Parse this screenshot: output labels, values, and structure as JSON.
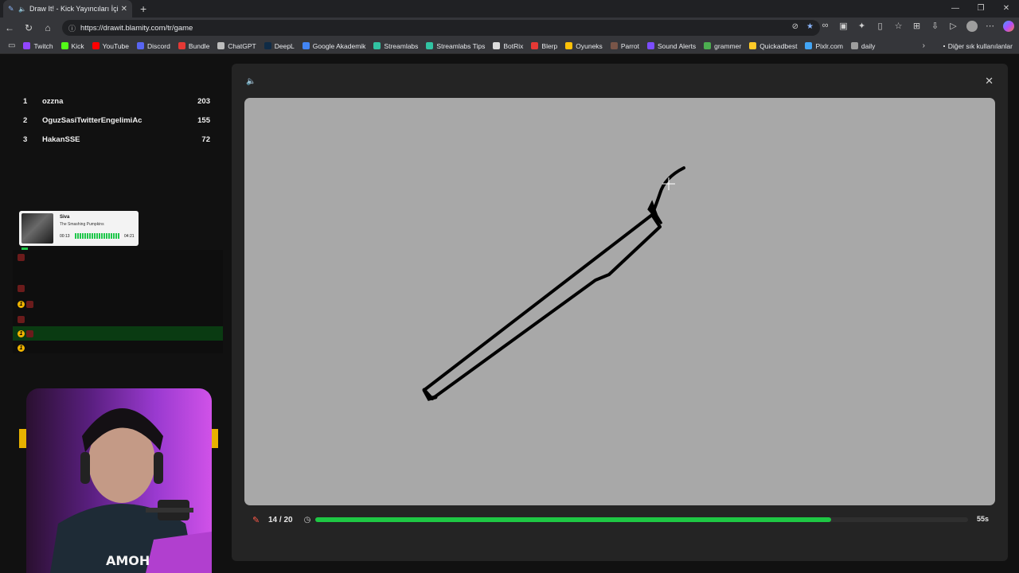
{
  "browser": {
    "tab_title": "Draw It! - Kick Yayıncıları İçin Ç",
    "url": "https://drawit.blamity.com/tr/game",
    "bookmarks": [
      {
        "label": "Twitch",
        "color": "#9146ff"
      },
      {
        "label": "Kick",
        "color": "#53fc18"
      },
      {
        "label": "YouTube",
        "color": "#ff0000"
      },
      {
        "label": "Discord",
        "color": "#5865f2"
      },
      {
        "label": "Bundle",
        "color": "#e53935"
      },
      {
        "label": "ChatGPT",
        "color": "#bdbdbd"
      },
      {
        "label": "DeepL",
        "color": "#0f2b46"
      },
      {
        "label": "Google Akademik",
        "color": "#4285f4"
      },
      {
        "label": "Streamlabs",
        "color": "#31c3a2"
      },
      {
        "label": "Streamlabs Tips",
        "color": "#31c3a2"
      },
      {
        "label": "BotRix",
        "color": "#dddddd"
      },
      {
        "label": "Blerp",
        "color": "#e53935"
      },
      {
        "label": "Oyuneks",
        "color": "#ffc107"
      },
      {
        "label": "Parrot",
        "color": "#795548"
      },
      {
        "label": "Sound Alerts",
        "color": "#7c4dff"
      },
      {
        "label": "grammer",
        "color": "#4caf50"
      },
      {
        "label": "Quickadbest",
        "color": "#ffca28"
      },
      {
        "label": "Pixlr.com",
        "color": "#42a5f5"
      },
      {
        "label": "daily",
        "color": "#9e9e9e"
      }
    ],
    "other_bookmarks": "Diğer sık kullanılanlar"
  },
  "leaderboard": [
    {
      "rank": "1",
      "name": "ozzna",
      "score": "203"
    },
    {
      "rank": "2",
      "name": "OguzSasiTwitterEngelimiAc",
      "score": "155"
    },
    {
      "rank": "3",
      "name": "HakanSSE",
      "score": "72"
    }
  ],
  "now_playing": {
    "title": "Siva",
    "artist": "The Smashing Pumpkins",
    "elapsed": "00:13",
    "duration": "04:21"
  },
  "game": {
    "round": "14 / 20",
    "time_left": "55s",
    "progress": 0.79
  },
  "colors": {
    "accent_green": "#1ec744",
    "canvas_bg": "#a8a8a8",
    "modal_bg": "#242424"
  }
}
